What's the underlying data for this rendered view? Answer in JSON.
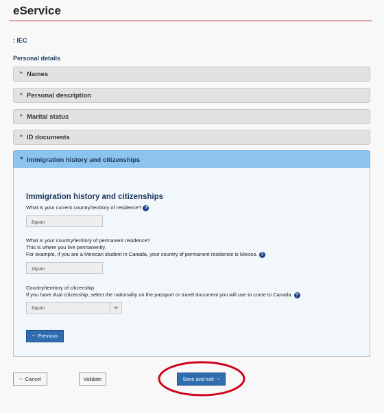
{
  "header": {
    "title": "eService"
  },
  "context": {
    "label": ": IEC"
  },
  "section": {
    "label": "Personal details"
  },
  "accordion": {
    "items": [
      {
        "label": "Names",
        "icon": "chevron-right-icon"
      },
      {
        "label": "Personal description",
        "icon": "chevron-right-icon"
      },
      {
        "label": "Marital status",
        "icon": "chevron-right-icon"
      },
      {
        "label": "ID documents",
        "icon": "chevron-right-icon"
      },
      {
        "label": "Immigration history and citizenships",
        "icon": "chevron-down-icon",
        "expanded": true
      }
    ]
  },
  "panel": {
    "title": "Immigration history and citizenships",
    "q1": {
      "label": "What is your current country/territory of residence?",
      "value": "Japan"
    },
    "q2": {
      "line1": "What is your country/territory of permanent residence?",
      "line2": "This is where you live permanently.",
      "line3": "For example, if you are a Mexican student in Canada, your country of permanent residence is Mexico.",
      "value": "Japan"
    },
    "q3": {
      "line1": "Country/territory of citizenship",
      "line2": "If you have dual citizenship, select the nationality on the passport or travel document you will use to come to Canada.",
      "value": "Japan"
    },
    "previous_label": "Previous",
    "help_glyph": "?"
  },
  "footer": {
    "cancel_label": "Cancel",
    "validate_label": "Validate",
    "save_label": "Save and exit"
  },
  "annotation": {
    "color": "#d0021b"
  },
  "colors": {
    "accent": "#2f6db0",
    "expanded_header": "#8dc4ef",
    "title_rule": "#aa3333"
  }
}
